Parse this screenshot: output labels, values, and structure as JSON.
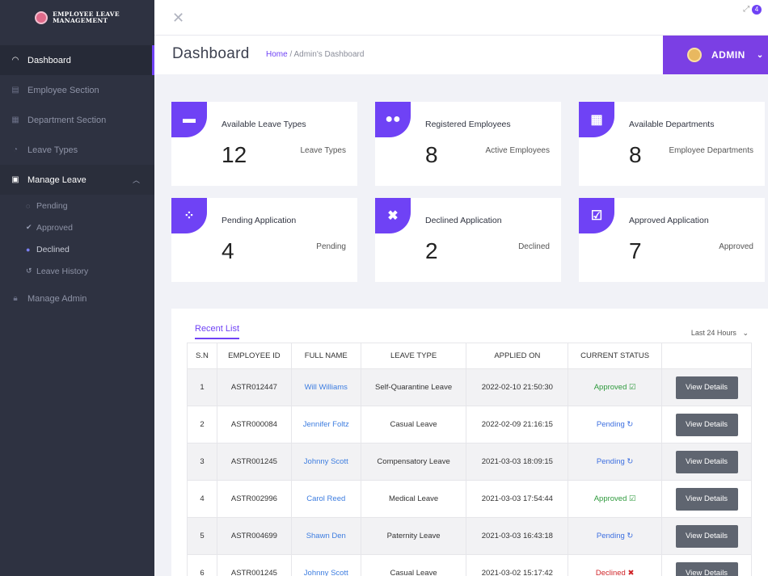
{
  "app": {
    "logo_line1": "Employee Leave",
    "logo_line2": "Management"
  },
  "sidebar": {
    "items": [
      {
        "label": "Dashboard"
      },
      {
        "label": "Employee Section"
      },
      {
        "label": "Department Section"
      },
      {
        "label": "Leave Types"
      },
      {
        "label": "Manage Leave"
      },
      {
        "label": "Manage Admin"
      }
    ],
    "sub_items": [
      {
        "label": "Pending"
      },
      {
        "label": "Approved"
      },
      {
        "label": "Declined"
      },
      {
        "label": "Leave History"
      }
    ]
  },
  "topbar": {
    "close_glyph": "✕",
    "notif_count": "4"
  },
  "header": {
    "title": "Dashboard",
    "crumb_home": "Home",
    "crumb_sep": "/",
    "crumb_current": "Admin's Dashboard",
    "user_label": "ADMIN"
  },
  "cards": [
    {
      "title": "Available Leave Types",
      "value": "12",
      "sub": "Leave Types",
      "icon": "briefcase-icon"
    },
    {
      "title": "Registered Employees",
      "value": "8",
      "sub": "Active Employees",
      "icon": "users-icon"
    },
    {
      "title": "Available Departments",
      "value": "8",
      "sub": "Employee Departments",
      "icon": "grid-icon"
    },
    {
      "title": "Pending Application",
      "value": "4",
      "sub": "Pending",
      "icon": "spinner-icon"
    },
    {
      "title": "Declined Application",
      "value": "2",
      "sub": "Declined",
      "icon": "x-icon"
    },
    {
      "title": "Approved Application",
      "value": "7",
      "sub": "Approved",
      "icon": "check-square-icon"
    }
  ],
  "recent": {
    "tab_label": "Recent List",
    "filter_label": "Last 24 Hours",
    "columns": [
      "S.N",
      "EMPLOYEE ID",
      "FULL NAME",
      "LEAVE TYPE",
      "APPLIED ON",
      "CURRENT STATUS",
      ""
    ],
    "button_label": "View Details",
    "rows": [
      {
        "sn": "1",
        "id": "ASTR012447",
        "name": "Will Williams",
        "type": "Self-Quarantine Leave",
        "applied": "2022-02-10 21:50:30",
        "status": "Approved"
      },
      {
        "sn": "2",
        "id": "ASTR000084",
        "name": "Jennifer Foltz",
        "type": "Casual Leave",
        "applied": "2022-02-09 21:16:15",
        "status": "Pending"
      },
      {
        "sn": "3",
        "id": "ASTR001245",
        "name": "Johnny Scott",
        "type": "Compensatory Leave",
        "applied": "2021-03-03 18:09:15",
        "status": "Pending"
      },
      {
        "sn": "4",
        "id": "ASTR002996",
        "name": "Carol Reed",
        "type": "Medical Leave",
        "applied": "2021-03-03 17:54:44",
        "status": "Approved"
      },
      {
        "sn": "5",
        "id": "ASTR004699",
        "name": "Shawn Den",
        "type": "Paternity Leave",
        "applied": "2021-03-03 16:43:18",
        "status": "Pending"
      },
      {
        "sn": "6",
        "id": "ASTR001245",
        "name": "Johnny Scott",
        "type": "Casual Leave",
        "applied": "2021-03-02 15:17:42",
        "status": "Declined"
      }
    ]
  },
  "colors": {
    "accent": "#6f42f5",
    "sidebar": "#2e3241",
    "approved": "#2e9a3c",
    "pending": "#3d6fe0",
    "declined": "#d0262a"
  }
}
